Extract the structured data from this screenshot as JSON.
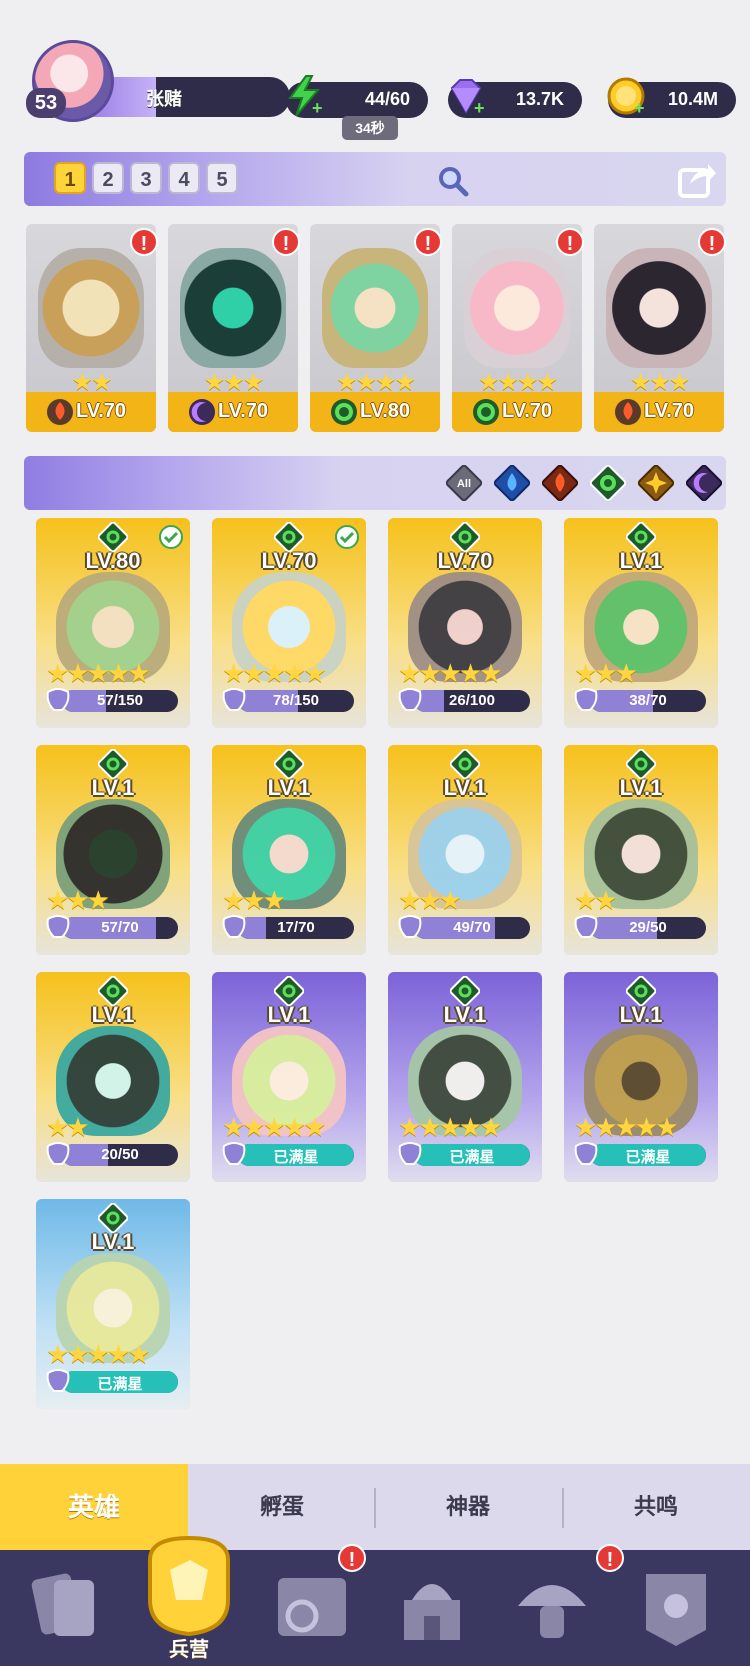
{
  "player": {
    "level": "53",
    "name": "张赌"
  },
  "resources": {
    "energy": "44/60",
    "energy_timer": "34秒",
    "gems": "13.7K",
    "coins": "10.4M"
  },
  "team_tabs": [
    "1",
    "2",
    "3",
    "4",
    "5"
  ],
  "team": [
    {
      "level": "LV.70",
      "stars": "★★",
      "element": "fire"
    },
    {
      "level": "LV.70",
      "stars": "★★★",
      "element": "dark"
    },
    {
      "level": "LV.80",
      "stars": "★★★★",
      "element": "wind"
    },
    {
      "level": "LV.70",
      "stars": "★★★★",
      "element": "wind"
    },
    {
      "level": "LV.70",
      "stars": "★★★",
      "element": "fire"
    }
  ],
  "filters": [
    "All",
    "water",
    "fire",
    "wind",
    "light",
    "dark"
  ],
  "filter_all_label": "All",
  "heroes": [
    {
      "level": "LV.80",
      "stars": "★★★★★",
      "progress": "57/150",
      "fill": 0.38,
      "frame": "gold",
      "in_team": true
    },
    {
      "level": "LV.70",
      "stars": "★★★★★",
      "progress": "78/150",
      "fill": 0.52,
      "frame": "gold",
      "in_team": true
    },
    {
      "level": "LV.70",
      "stars": "★★★★★",
      "progress": "26/100",
      "fill": 0.26,
      "frame": "gold",
      "in_team": false
    },
    {
      "level": "LV.1",
      "stars": "★★★",
      "progress": "38/70",
      "fill": 0.54,
      "frame": "gold",
      "in_team": false
    },
    {
      "level": "LV.1",
      "stars": "★★★",
      "progress": "57/70",
      "fill": 0.81,
      "frame": "gold",
      "in_team": false
    },
    {
      "level": "LV.1",
      "stars": "★★★",
      "progress": "17/70",
      "fill": 0.24,
      "frame": "gold",
      "in_team": false
    },
    {
      "level": "LV.1",
      "stars": "★★★",
      "progress": "49/70",
      "fill": 0.7,
      "frame": "gold",
      "in_team": false
    },
    {
      "level": "LV.1",
      "stars": "★★",
      "progress": "29/50",
      "fill": 0.58,
      "frame": "gold",
      "in_team": false
    },
    {
      "level": "LV.1",
      "stars": "★★",
      "progress": "20/50",
      "fill": 0.4,
      "frame": "gold",
      "in_team": false
    },
    {
      "level": "LV.1",
      "stars": "★★★★★",
      "progress": "已满星",
      "fill": 1.0,
      "frame": "violet",
      "in_team": false
    },
    {
      "level": "LV.1",
      "stars": "★★★★★",
      "progress": "已满星",
      "fill": 1.0,
      "frame": "violet",
      "in_team": false
    },
    {
      "level": "LV.1",
      "stars": "★★★★★",
      "progress": "已满星",
      "fill": 1.0,
      "frame": "violet",
      "in_team": false
    },
    {
      "level": "LV.1",
      "stars": "★★★★★",
      "progress": "已满星",
      "fill": 1.0,
      "frame": "sky",
      "in_team": false
    }
  ],
  "sub_tabs": [
    "英雄",
    "孵蛋",
    "神器",
    "共鸣"
  ],
  "bottom_nav": {
    "active_label": "兵营"
  },
  "colors": {
    "accent": "#ffd23a",
    "nav_bg": "#3a3760",
    "alert": "#e53935"
  }
}
